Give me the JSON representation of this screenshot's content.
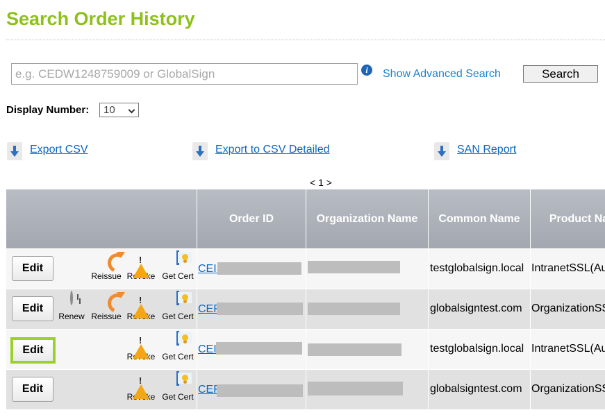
{
  "page_title": "Search Order History",
  "search": {
    "placeholder": "e.g. CEDW1248759009 or GlobalSign",
    "advanced_link": "Show Advanced Search",
    "button_label": "Search"
  },
  "display": {
    "label": "Display Number:",
    "value": "10"
  },
  "exports": [
    {
      "label": "Export CSV"
    },
    {
      "label": "Export to CSV Detailed"
    },
    {
      "label": "SAN Report"
    }
  ],
  "pager": "< 1 >",
  "table": {
    "headers": [
      "",
      "Order ID",
      "Organization Name",
      "Common Name",
      "Product Na"
    ],
    "action_labels": {
      "edit": "Edit",
      "renew": "Renew",
      "reissue": "Reissue",
      "revoke": "Revoke",
      "get_cert": "Get Cert"
    },
    "rows": [
      {
        "order_prefix": "CEIS",
        "common_name": "testglobalsign.local",
        "product": "IntranetSSL(Au",
        "actions": [
          "reissue",
          "revoke",
          "get_cert"
        ],
        "highlighted": false
      },
      {
        "order_prefix": "CEF",
        "common_name": "globalsigntest.com",
        "product": "OrganizationSS",
        "actions": [
          "renew",
          "reissue",
          "revoke",
          "get_cert"
        ],
        "highlighted": false
      },
      {
        "order_prefix": "CEI",
        "common_name": "testglobalsign.local",
        "product": "IntranetSSL(Au",
        "actions": [
          "revoke",
          "get_cert"
        ],
        "highlighted": true
      },
      {
        "order_prefix": "CEF",
        "common_name": "globalsigntest.com",
        "product": "OrganizationSS",
        "actions": [
          "revoke",
          "get_cert"
        ],
        "highlighted": false
      }
    ]
  },
  "colors": {
    "title": "#8dc11a",
    "link": "#0b66c3",
    "header_bg": "#a3a8b0",
    "highlight": "#9bd12a"
  }
}
